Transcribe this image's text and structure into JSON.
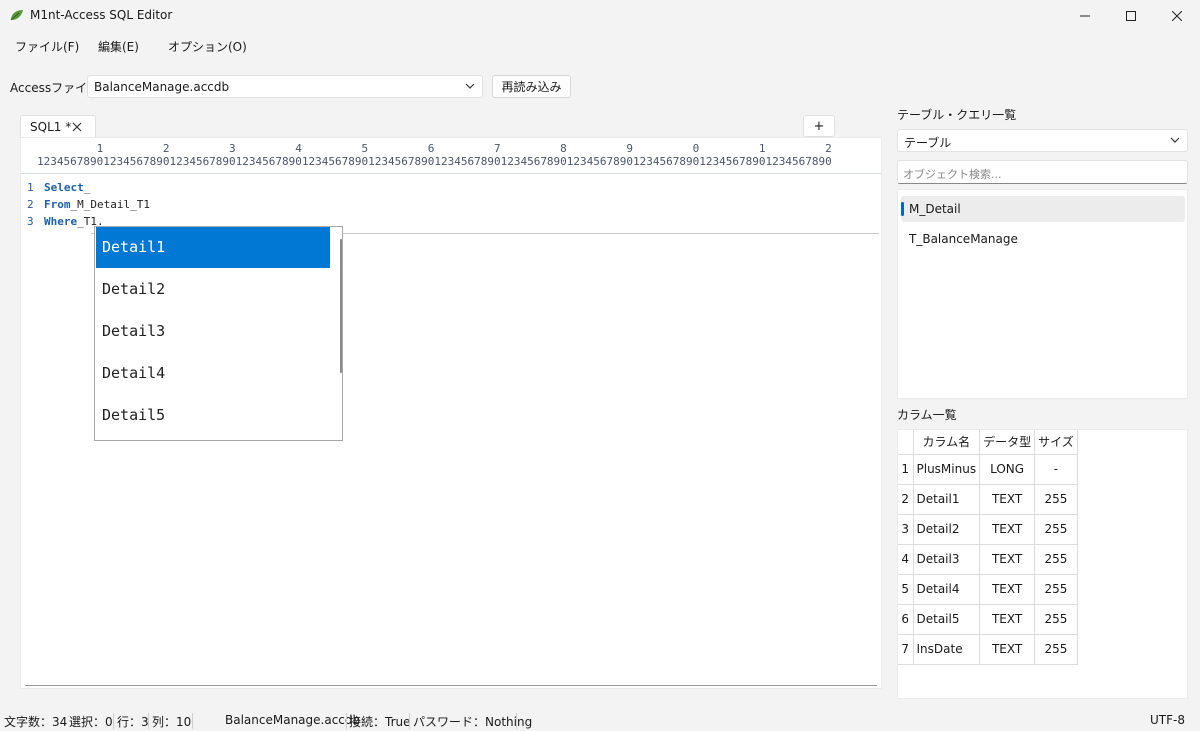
{
  "window": {
    "title": "M1nt-Access SQL Editor"
  },
  "menu": {
    "file": "ファイル(F)",
    "edit": "編集(E)",
    "options": "オプション(O)"
  },
  "file_row": {
    "label": "Accessファイル",
    "selected_file": "BalanceManage.accdb",
    "reload_label": "再読み込み"
  },
  "editor": {
    "tab_label": "SQL1 *",
    "add_tab_label": "+",
    "ruler_tens": "         1         2         3         4         5         6         7         8         9         0         1         2",
    "ruler_ones": "123456789012345678901234567890123456789012345678901234567890123456789012345678901234567890123456789012345678901234567890",
    "lines": [
      {
        "num": "1",
        "keyword": "Select",
        "rest": "_"
      },
      {
        "num": "2",
        "keyword": "From",
        "rest": "_M_Detail_T1"
      },
      {
        "num": "3",
        "keyword": "Where",
        "rest": "_T1."
      }
    ]
  },
  "autocomplete": {
    "items": [
      "Detail1",
      "Detail2",
      "Detail3",
      "Detail4",
      "Detail5"
    ],
    "selected_index": 0
  },
  "objects": {
    "label": "テーブル・クエリ一覧",
    "type_value": "テーブル",
    "search_placeholder": "オブジェクト検索...",
    "items": [
      "M_Detail",
      "T_BalanceManage"
    ],
    "selected": "M_Detail"
  },
  "columns": {
    "label": "カラム一覧",
    "headers": [
      "カラム名",
      "データ型",
      "サイズ"
    ],
    "rows": [
      {
        "n": "1",
        "name": "PlusMinus",
        "type": "LONG",
        "size": "-"
      },
      {
        "n": "2",
        "name": "Detail1",
        "type": "TEXT",
        "size": "255"
      },
      {
        "n": "3",
        "name": "Detail2",
        "type": "TEXT",
        "size": "255"
      },
      {
        "n": "4",
        "name": "Detail3",
        "type": "TEXT",
        "size": "255"
      },
      {
        "n": "5",
        "name": "Detail4",
        "type": "TEXT",
        "size": "255"
      },
      {
        "n": "6",
        "name": "Detail5",
        "type": "TEXT",
        "size": "255"
      },
      {
        "n": "7",
        "name": "InsDate",
        "type": "TEXT",
        "size": "255"
      }
    ]
  },
  "status": {
    "chars": "文字数：34",
    "selection": "選択：0",
    "line": "行：3",
    "column": "列：10",
    "file": "BalanceManage.accdb",
    "connection": "接続：True",
    "password": "パスワード：Nothing",
    "encoding": "UTF-8"
  },
  "colors": {
    "accent": "#0078d4",
    "keyword": "#1f5fa8"
  },
  "icons": [
    "app-leaf-icon",
    "minimize-icon",
    "maximize-icon",
    "close-icon",
    "chevron-down-icon",
    "tab-close-icon"
  ]
}
